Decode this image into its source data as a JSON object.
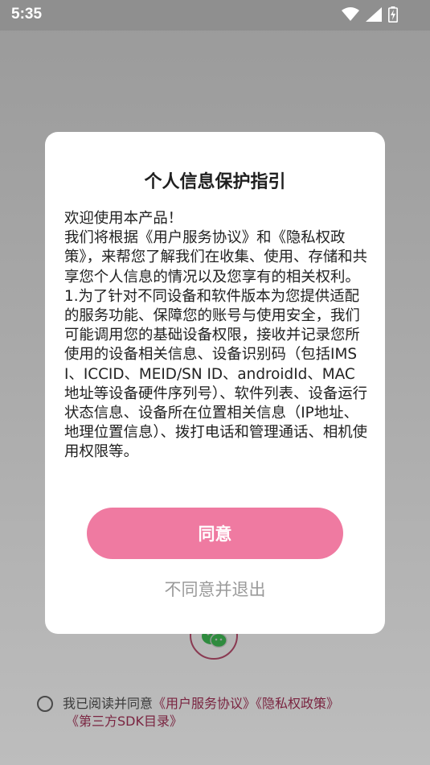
{
  "status_bar": {
    "time": "5:35",
    "icons": [
      "wifi-icon",
      "cellular-signal-icon",
      "battery-charging-icon"
    ]
  },
  "background": {
    "login_icon": "wechat-icon",
    "agreement": {
      "prefix": "我已阅读并同意",
      "link_user_agreement": "《用户服务协议》",
      "link_privacy_policy": "《隐私权政策》",
      "link_sdk_list": "《第三方SDK目录》"
    }
  },
  "dialog": {
    "title": "个人信息保护指引",
    "paragraphs": [
      "欢迎使用本产品！",
      "我们将根据《用户服务协议》和《隐私权政策》，来帮您了解我们在收集、使用、存储和共享您个人信息的情况以及您享有的相关权利。",
      "1.为了针对不同设备和软件版本为您提供适配的服务功能、保障您的账号与使用安全，我们可能调用您的基础设备权限，接收并记录您所使用的设备相关信息、设备识别码（包括IMSI、ICCID、MEID/SN ID、androidId、MAC地址等设备硬件序列号）、软件列表、设备运行状态信息、设备所在位置相关信息（IP地址、地理位置信息）、拨打电话和管理通话、相机使用权限等。"
    ],
    "agree_label": "同意",
    "decline_label": "不同意并退出"
  },
  "colors": {
    "accent": "#ef7aa1",
    "link": "#7a2440",
    "overlay": "#9b9b9b"
  }
}
